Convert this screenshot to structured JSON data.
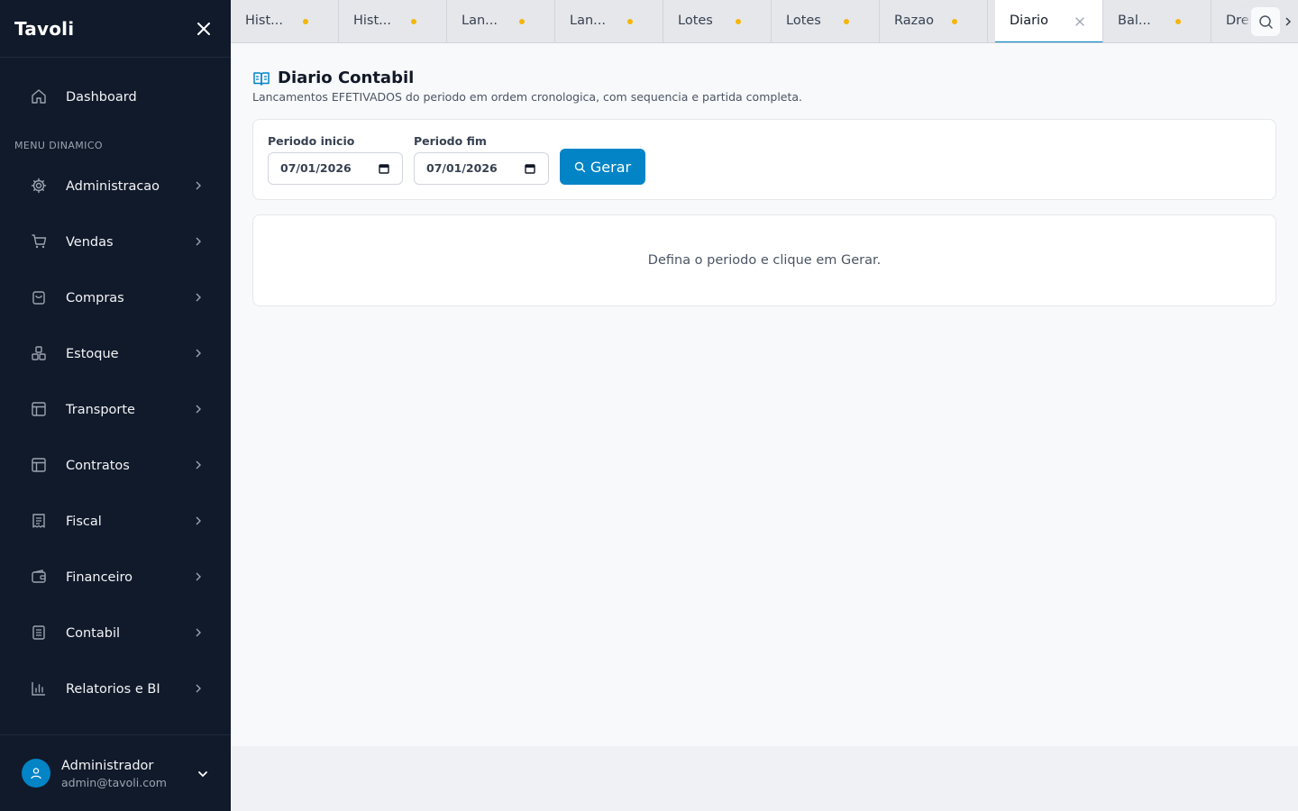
{
  "app": {
    "brand": "Tavoli"
  },
  "sidebar": {
    "dashboard": {
      "label": "Dashboard",
      "icon": "home-icon"
    },
    "section_label": "MENU DINAMICO",
    "items": [
      {
        "label": "Administracao",
        "icon": "gear-icon"
      },
      {
        "label": "Vendas",
        "icon": "cart-icon"
      },
      {
        "label": "Compras",
        "icon": "shopping-bag-icon"
      },
      {
        "label": "Estoque",
        "icon": "boxes-icon"
      },
      {
        "label": "Transporte",
        "icon": "layout-icon"
      },
      {
        "label": "Contratos",
        "icon": "layout-icon"
      },
      {
        "label": "Fiscal",
        "icon": "receipt-icon"
      },
      {
        "label": "Financeiro",
        "icon": "wallet-icon"
      },
      {
        "label": "Contabil",
        "icon": "notebook-icon"
      },
      {
        "label": "Relatorios e BI",
        "icon": "bar-chart-icon"
      }
    ],
    "user": {
      "name": "Administrador",
      "email": "admin@tavoli.com"
    }
  },
  "tabs": [
    {
      "label": "Hist...",
      "unsaved": true,
      "active": false
    },
    {
      "label": "Hist...",
      "unsaved": true,
      "active": false
    },
    {
      "label": "Lan...",
      "unsaved": true,
      "active": false
    },
    {
      "label": "Lan...",
      "unsaved": true,
      "active": false
    },
    {
      "label": "Lotes",
      "unsaved": true,
      "active": false
    },
    {
      "label": "Lotes",
      "unsaved": true,
      "active": false
    },
    {
      "label": "Razao",
      "unsaved": true,
      "active": false
    },
    {
      "label": "Diario",
      "unsaved": false,
      "active": true
    },
    {
      "label": "Bal...",
      "unsaved": true,
      "active": false
    },
    {
      "label": "Dre",
      "unsaved": false,
      "active": false
    }
  ],
  "main": {
    "title": "Diario Contabil",
    "subtitle": "Lancamentos EFETIVADOS do periodo em ordem cronologica, com sequencia e partida completa.",
    "filters": {
      "start_label": "Periodo inicio",
      "start_value": "07/01/2026",
      "end_label": "Periodo fim",
      "end_value": "07/01/2026",
      "generate_label": "Gerar"
    },
    "empty_message": "Defina o periodo e clique em Gerar."
  },
  "colors": {
    "sidebar_bg": "#111a2b",
    "accent": "#0284c7",
    "unsaved_dot": "#f5b50a"
  }
}
